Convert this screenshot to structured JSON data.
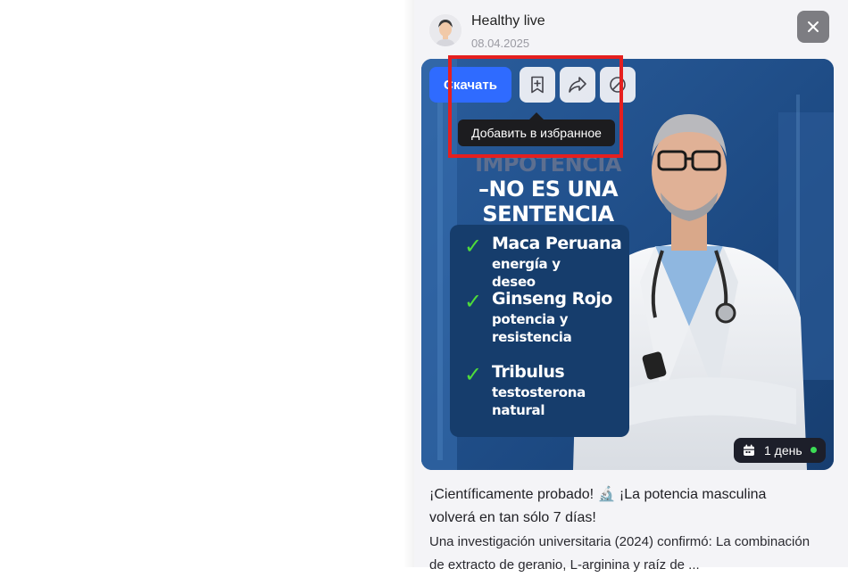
{
  "post": {
    "author": "Healthy live",
    "date": "08.04.2025"
  },
  "actions": {
    "download_label": "Скачать",
    "favorite_tooltip": "Добавить в избранное"
  },
  "creative": {
    "headline_line1": "IMPOTENCIA",
    "headline_line2": "–NO ES UNA",
    "headline_line3": "SENTENCIA",
    "ingredients": [
      {
        "name": "Maca Peruana",
        "desc": "energía y deseo"
      },
      {
        "name": "Ginseng Rojo",
        "desc": "potencia y resistencia"
      },
      {
        "name": "Tribulus",
        "desc": "testosterona natural"
      }
    ],
    "duration_badge": "1 день",
    "status_color": "#3cdd55"
  },
  "caption": {
    "title": "¡Científicamente probado! 🔬 ¡La potencia masculina volverá en tan sólo 7 días!",
    "body": "Una investigación universitaria (2024) confirmó: La combinación de extracto de geranio, L-arginina y raíz de ..."
  },
  "colors": {
    "accent": "#2f6bff",
    "highlight": "#e51f1f"
  }
}
